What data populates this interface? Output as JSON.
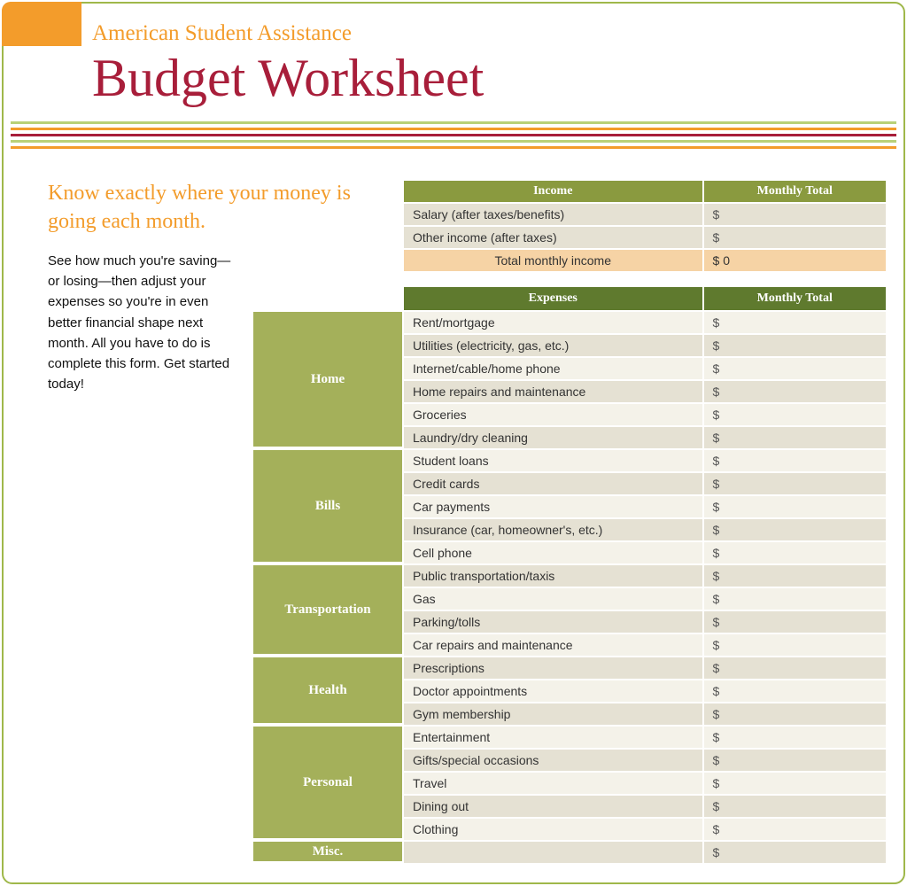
{
  "header": {
    "subtitle": "American Student Assistance",
    "title": "Budget Worksheet"
  },
  "intro": {
    "heading": "Know exactly where your money is going each month.",
    "body": "See how much you're saving—or losing—then adjust your expenses so you're in even better financial shape next month. All you have to do is complete this form. Get started today!"
  },
  "income": {
    "header_label": "Income",
    "header_total": "Monthly Total",
    "rows": [
      {
        "label": "Salary (after taxes/benefits)",
        "value": "$"
      },
      {
        "label": "Other income (after taxes)",
        "value": "$"
      }
    ],
    "total_label": "Total monthly income",
    "total_value": "$  0"
  },
  "expenses": {
    "header_label": "Expenses",
    "header_total": "Monthly Total",
    "categories": [
      {
        "name": "Home",
        "rows": 6,
        "items": [
          "Rent/mortgage",
          "Utilities (electricity, gas, etc.)",
          "Internet/cable/home phone",
          "Home repairs and maintenance",
          "Groceries",
          "Laundry/dry cleaning"
        ]
      },
      {
        "name": "Bills",
        "rows": 5,
        "items": [
          "Student loans",
          "Credit cards",
          "Car payments",
          "Insurance (car, homeowner's, etc.)",
          "Cell phone"
        ]
      },
      {
        "name": "Transportation",
        "rows": 4,
        "items": [
          "Public transportation/taxis",
          "Gas",
          "Parking/tolls",
          "Car repairs and maintenance"
        ]
      },
      {
        "name": "Health",
        "rows": 3,
        "items": [
          "Prescriptions",
          "Doctor appointments",
          "Gym membership"
        ]
      },
      {
        "name": "Personal",
        "rows": 5,
        "items": [
          "Entertainment",
          "Gifts/special occasions",
          "Travel",
          "Dining out",
          "Clothing"
        ]
      },
      {
        "name": "Misc.",
        "rows": 1,
        "items": [
          ""
        ]
      }
    ],
    "value_placeholder": "$"
  }
}
